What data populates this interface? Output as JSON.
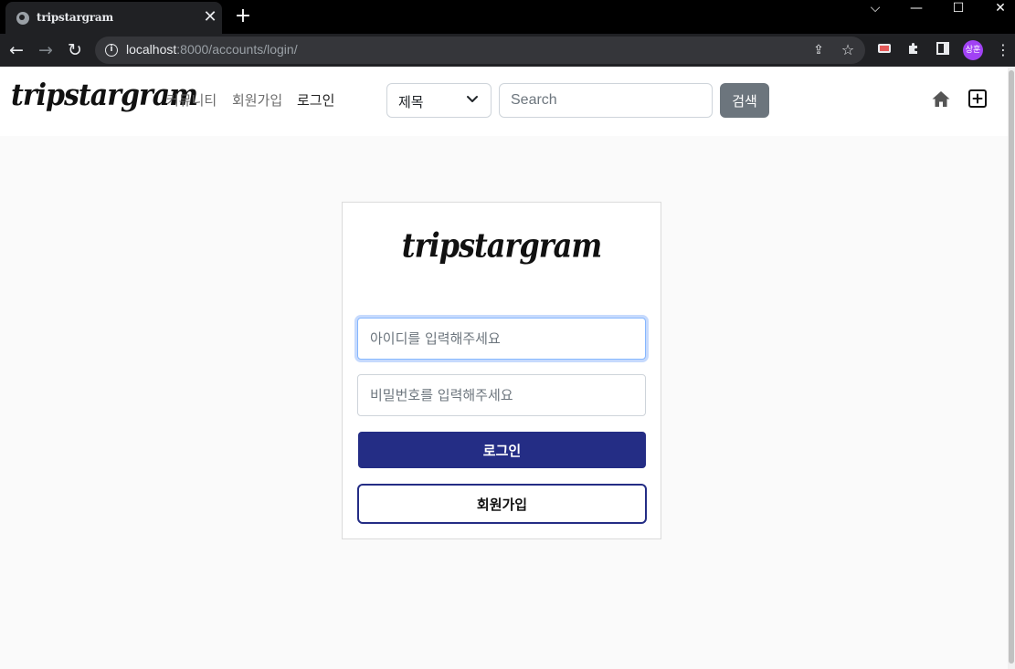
{
  "browser": {
    "tab_title": "tripstargram",
    "tab_close_glyph": "✕",
    "new_tab_glyph": "+",
    "url_host": "localhost",
    "url_rest": ":8000/accounts/login/",
    "profile_initials": "상훈",
    "window_controls": {
      "chevron": "⌵",
      "minimize": "—",
      "maximize": "☐",
      "close": "✕"
    },
    "nav": {
      "back": "←",
      "forward": "→",
      "reload": "↻"
    },
    "icons": {
      "share": "⇪",
      "star": "☆",
      "menu": "⋮",
      "info": "i"
    }
  },
  "site": {
    "brand": "tripstargram",
    "nav_links": [
      "커뮤니티",
      "회원가입",
      "로그인"
    ],
    "active_link": "로그인",
    "search": {
      "select_value": "제목",
      "placeholder": "Search",
      "button_label": "검색"
    }
  },
  "login": {
    "brand": "tripstargram",
    "id_placeholder": "아이디를 입력해주세요",
    "password_placeholder": "비밀번호를 입력해주세요",
    "login_button": "로그인",
    "signup_button": "회원가입"
  },
  "colors": {
    "primary": "#242d85",
    "search_button": "#6c757d",
    "focus_ring": "#86b7fe"
  }
}
